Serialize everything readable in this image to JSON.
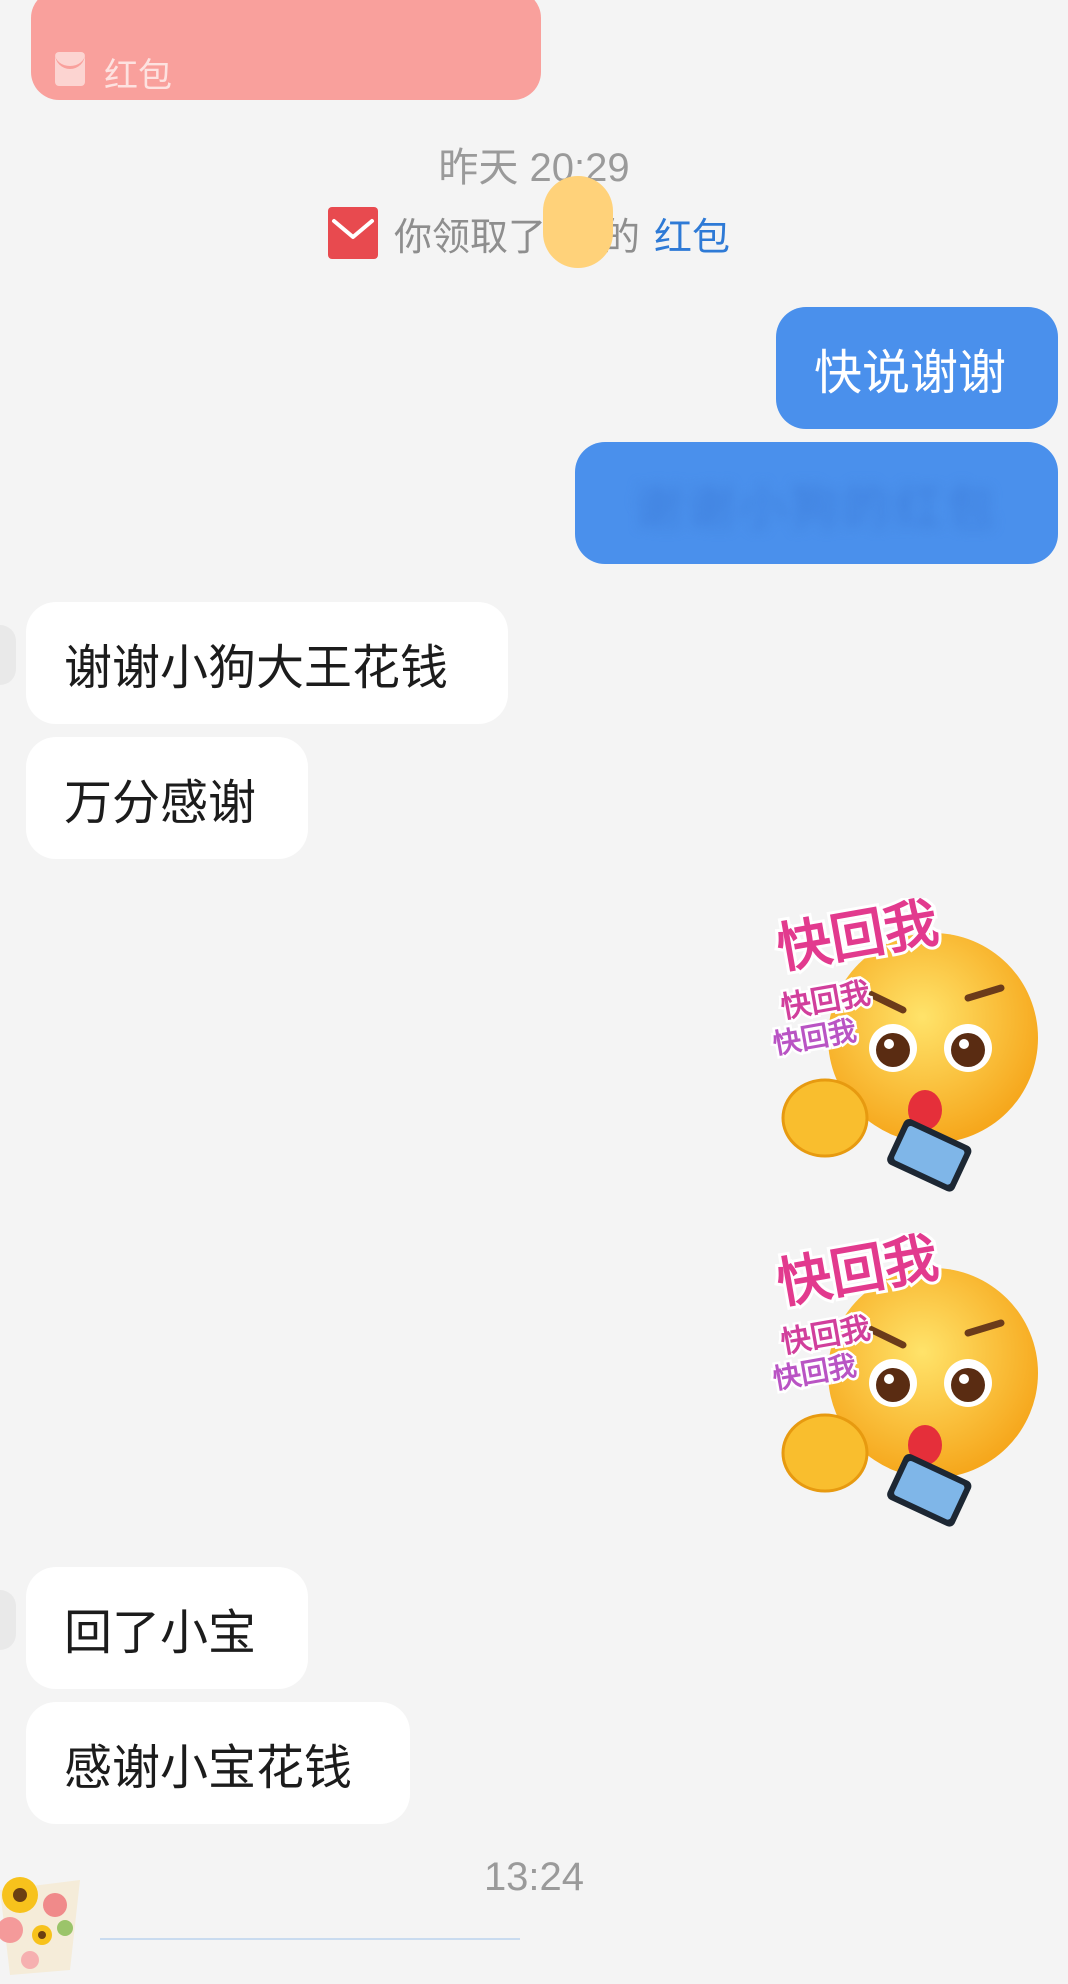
{
  "red_packet_card": {
    "label": "红包"
  },
  "timestamps": {
    "first": "昨天 20:29",
    "second": "13:24"
  },
  "system_notice": {
    "prefix": "你领取了",
    "suffix": "的",
    "link": "红包"
  },
  "messages_out": [
    {
      "text": "快说谢谢"
    },
    {
      "text": "谢谢小狗的红包"
    }
  ],
  "messages_in_1": [
    {
      "text": "谢谢小狗大王花钱"
    },
    {
      "text": "万分感谢"
    }
  ],
  "stickers": [
    {
      "icon": "quick-reply-emoji-sticker",
      "caption_main": "快回我",
      "caption_small_1": "快回我",
      "caption_small_2": "快回我"
    },
    {
      "icon": "quick-reply-emoji-sticker",
      "caption_main": "快回我",
      "caption_small_1": "快回我",
      "caption_small_2": "快回我"
    }
  ],
  "messages_in_2": [
    {
      "text": "回了小宝"
    },
    {
      "text": "感谢小宝花钱"
    }
  ],
  "colors": {
    "background": "#f4f4f4",
    "outgoing_bubble": "#4a90ec",
    "incoming_bubble": "#ffffff",
    "red_packet": "#f9a09c",
    "link": "#2e7ad6"
  }
}
